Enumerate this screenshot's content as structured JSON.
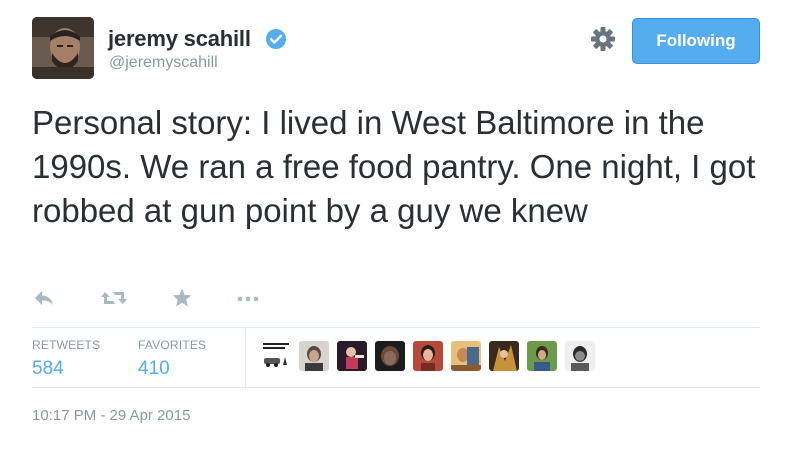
{
  "user": {
    "display_name": "jeremy scahill",
    "username": "@jeremyscahill",
    "verified": true
  },
  "follow_button": {
    "label": "Following",
    "color": "#55acee"
  },
  "tweet": {
    "text": "Personal story: I lived in West Baltimore in the 1990s. We ran a free food pantry. One night, I got robbed at gun point by a guy we knew"
  },
  "actions": {
    "icons": [
      "reply-icon",
      "retweet-icon",
      "favorite-icon",
      "more-icon"
    ]
  },
  "stats": {
    "retweets_label": "RETWEETS",
    "retweets_count": "584",
    "favorites_label": "FAVORITES",
    "favorites_count": "410"
  },
  "favoriters": {
    "first_avatar_text": "TRANSIT SLEUTH"
  },
  "timestamp": "10:17 PM - 29 Apr 2015",
  "colors": {
    "accent": "#55acee",
    "text": "#292f33",
    "muted": "#8899a6",
    "divider": "#e1e8ed"
  }
}
